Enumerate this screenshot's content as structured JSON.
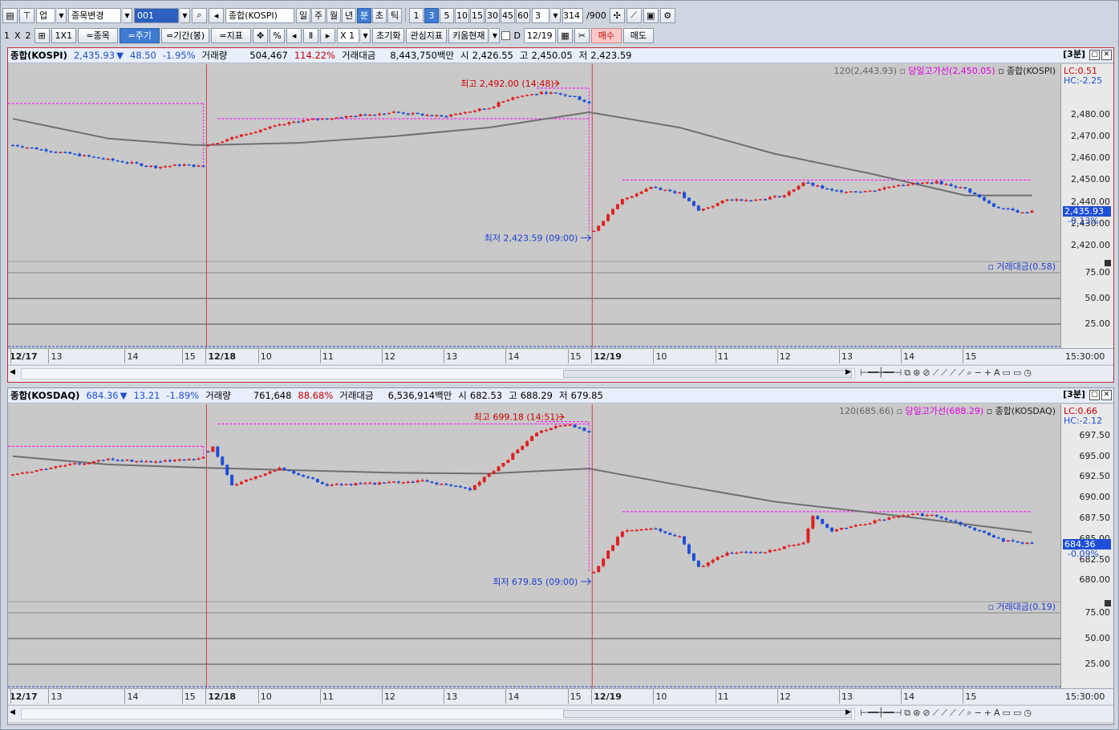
{
  "toolbar1": {
    "market": "업",
    "item_change": "종목변경",
    "code": "001",
    "index_name": "종합(KOSPI)",
    "periods": [
      "일",
      "주",
      "월",
      "년",
      "분",
      "초",
      "틱"
    ],
    "active_period": "분",
    "minutes": [
      "1",
      "3",
      "5",
      "10",
      "15",
      "30",
      "45",
      "60"
    ],
    "active_minute": "3",
    "unit": "3",
    "count": "314",
    "max": "/900"
  },
  "toolbar2": {
    "layout": [
      "1",
      "X",
      "2"
    ],
    "one_by_one": "1X1",
    "item_btn": "=종목",
    "cycle_btn": "=주기",
    "range_btn": "=기간(봉)",
    "indicator_btn": "=지표",
    "pct": "%",
    "zoom": "X 1",
    "reset": "초기화",
    "watch_ind": "관심지표",
    "kiwoom": "키움현재",
    "d_label": "D",
    "date": "12/19",
    "buy": "매수",
    "sell": "매도"
  },
  "panels": [
    {
      "name": "종합(KOSPI)",
      "price": "2,435.93",
      "arrow": "▼",
      "change": "48.50",
      "rate": "-1.95%",
      "vol_label": "거래량",
      "volume": "504,467",
      "vol_rate": "114.22%",
      "amt_label": "거래대금",
      "amount": "8,443,750백만",
      "open_label": "시",
      "open": "2,426.55",
      "high_label": "고",
      "high": "2,450.05",
      "low_label": "저",
      "low": "2,423.59",
      "period_label": "[3분]",
      "legend_ma": "120(2,443.93)",
      "legend_high": "당일고가선(2,450.05)",
      "legend_idx": "종합(KOSPI)",
      "lc": "LC:0.51",
      "hc": "HC:-2.25",
      "high_marker": "최고 2,492.00 (14:48)",
      "low_marker": "최저 2,423.59 (09:00)",
      "y_ticks": [
        "2,480.00",
        "2,470.00",
        "2,460.00",
        "2,450.00",
        "2,440.00",
        "2,430.00",
        "2,420.00"
      ],
      "cur_price": "2,435.93",
      "cur_rate": "-0.13%",
      "sub_label": "거래대금(0.58)",
      "sub_ticks": [
        "75.00",
        "50.00",
        "25.00"
      ],
      "x_labels": [
        "12/17",
        "13",
        "14",
        "15",
        "12/18",
        "10",
        "11",
        "12",
        "13",
        "14",
        "15",
        "12/19",
        "10",
        "11",
        "12",
        "13",
        "14",
        "15"
      ],
      "x_time": "15:30:00",
      "chart_data": {
        "type": "candlestick",
        "unit": "3분",
        "days": [
          "12/17",
          "12/18",
          "12/19"
        ],
        "ylim": [
          2415,
          2500
        ],
        "close_path": [
          [
            0,
            2466
          ],
          [
            12,
            2462
          ],
          [
            24,
            2458
          ],
          [
            30,
            2456
          ],
          [
            36,
            2457
          ],
          [
            40,
            2456
          ],
          [
            41,
            2466
          ],
          [
            50,
            2472
          ],
          [
            60,
            2477
          ],
          [
            70,
            2479
          ],
          [
            80,
            2481
          ],
          [
            90,
            2479
          ],
          [
            100,
            2483
          ],
          [
            105,
            2488
          ],
          [
            112,
            2490
          ],
          [
            118,
            2488
          ],
          [
            121,
            2485
          ],
          [
            122,
            2427
          ],
          [
            128,
            2441
          ],
          [
            134,
            2447
          ],
          [
            140,
            2444
          ],
          [
            144,
            2436
          ],
          [
            150,
            2441
          ],
          [
            156,
            2441
          ],
          [
            162,
            2443
          ],
          [
            166,
            2449
          ],
          [
            172,
            2445
          ],
          [
            180,
            2445
          ],
          [
            186,
            2448
          ],
          [
            194,
            2449
          ],
          [
            200,
            2446
          ],
          [
            206,
            2438
          ],
          [
            212,
            2435
          ],
          [
            214,
            2436
          ]
        ],
        "ma120": [
          [
            0,
            2478
          ],
          [
            20,
            2469
          ],
          [
            38,
            2466
          ],
          [
            41,
            2466
          ],
          [
            60,
            2467
          ],
          [
            80,
            2470
          ],
          [
            100,
            2474
          ],
          [
            121,
            2481
          ],
          [
            140,
            2474
          ],
          [
            160,
            2462
          ],
          [
            180,
            2453
          ],
          [
            200,
            2443
          ],
          [
            214,
            2443
          ]
        ],
        "day_high_line": 2450.05,
        "prev_close_lines": [
          2485.0,
          2478.0,
          2492.0
        ]
      }
    },
    {
      "name": "종합(KOSDAQ)",
      "price": "684.36",
      "arrow": "▼",
      "change": "13.21",
      "rate": "-1.89%",
      "vol_label": "거래량",
      "volume": "761,648",
      "vol_rate": "88.68%",
      "amt_label": "거래대금",
      "amount": "6,536,914백만",
      "open_label": "시",
      "open": "682.53",
      "high_label": "고",
      "high": "688.29",
      "low_label": "저",
      "low": "679.85",
      "period_label": "[3분]",
      "legend_ma": "120(685.66)",
      "legend_high": "당일고가선(688.29)",
      "legend_idx": "종합(KOSDAQ)",
      "lc": "LC:0.66",
      "hc": "HC:-2.12",
      "high_marker": "최고 699.18 (14:51)",
      "low_marker": "최저 679.85 (09:00)",
      "y_ticks": [
        "697.50",
        "695.00",
        "692.50",
        "690.00",
        "687.50",
        "685.00",
        "682.50",
        "680.00"
      ],
      "cur_price": "684.36",
      "cur_rate": "-0.09%",
      "sub_label": "거래대금(0.19)",
      "sub_ticks": [
        "75.00",
        "50.00",
        "25.00"
      ],
      "x_labels": [
        "12/17",
        "13",
        "14",
        "15",
        "12/18",
        "10",
        "11",
        "12",
        "13",
        "14",
        "15",
        "12/19",
        "10",
        "11",
        "12",
        "13",
        "14",
        "15"
      ],
      "x_time": "15:30:00",
      "chart_data": {
        "type": "candlestick",
        "unit": "3분",
        "days": [
          "12/17",
          "12/18",
          "12/19"
        ],
        "ylim": [
          678,
          700.5
        ],
        "close_path": [
          [
            0,
            692.8
          ],
          [
            10,
            693.8
          ],
          [
            20,
            694.6
          ],
          [
            30,
            694.3
          ],
          [
            38,
            694.6
          ],
          [
            40,
            694.8
          ],
          [
            42,
            696.2
          ],
          [
            46,
            691.5
          ],
          [
            56,
            693.6
          ],
          [
            66,
            691.5
          ],
          [
            76,
            691.7
          ],
          [
            86,
            692.0
          ],
          [
            96,
            691.0
          ],
          [
            104,
            694.7
          ],
          [
            110,
            697.8
          ],
          [
            116,
            698.9
          ],
          [
            121,
            698.0
          ],
          [
            122,
            681.0
          ],
          [
            128,
            686.0
          ],
          [
            134,
            686.4
          ],
          [
            140,
            685.2
          ],
          [
            144,
            681.5
          ],
          [
            150,
            683.3
          ],
          [
            158,
            683.5
          ],
          [
            166,
            684.5
          ],
          [
            168,
            687.8
          ],
          [
            172,
            686.0
          ],
          [
            180,
            687.0
          ],
          [
            188,
            688.0
          ],
          [
            194,
            687.8
          ],
          [
            200,
            686.6
          ],
          [
            208,
            684.8
          ],
          [
            214,
            684.4
          ]
        ],
        "ma120": [
          [
            0,
            695.0
          ],
          [
            20,
            694.0
          ],
          [
            40,
            693.6
          ],
          [
            60,
            693.3
          ],
          [
            80,
            693.0
          ],
          [
            100,
            692.9
          ],
          [
            121,
            693.5
          ],
          [
            140,
            691.5
          ],
          [
            160,
            689.5
          ],
          [
            180,
            688.2
          ],
          [
            200,
            686.8
          ],
          [
            214,
            685.8
          ]
        ],
        "day_high_line": 688.29,
        "prev_close_lines": [
          696.2,
          698.9,
          699.18
        ]
      }
    }
  ],
  "colors": {
    "up": "#e02020",
    "down": "#1f4fd8",
    "ma": "#707070",
    "high_line": "#ff00ff",
    "day_sep": "#d84040"
  }
}
